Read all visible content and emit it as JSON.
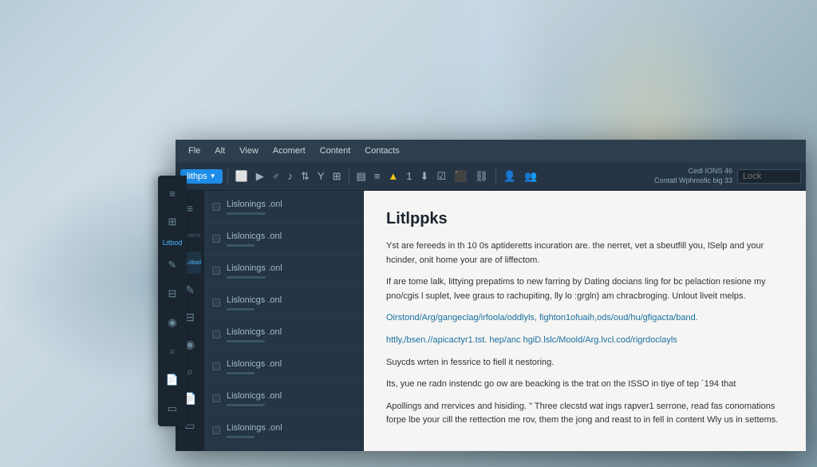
{
  "background": {
    "description": "blurred office background"
  },
  "menu": {
    "items": [
      "Fle",
      "Alt",
      "View",
      "Acomert",
      "Content",
      "Contacts"
    ]
  },
  "toolbar": {
    "dropdown_label": "lithps",
    "icons": [
      "⬜",
      "▶",
      "♂",
      "♪",
      "⇅",
      "Y",
      "⊞",
      "▤",
      "≡",
      "▲",
      "1",
      "⬇",
      "☑",
      "⬛",
      "⛓",
      "👤",
      "👥"
    ],
    "info_line1": "Cedl IONS 46",
    "info_line2": "Contatl Wphmofic big 33",
    "search_placeholder": "Lock"
  },
  "nav_icons": [
    {
      "icon": "≡",
      "label": "",
      "active": false
    },
    {
      "icon": "⊞",
      "label": "Name",
      "active": false
    },
    {
      "icon": "☰",
      "label": "Litbod",
      "active": true
    },
    {
      "icon": "✏",
      "label": "",
      "active": false
    },
    {
      "icon": "⊟",
      "label": "",
      "active": false
    },
    {
      "icon": "👤",
      "label": "",
      "active": false
    },
    {
      "icon": "🔍",
      "label": "",
      "active": false
    },
    {
      "icon": "📄",
      "label": "",
      "active": false
    },
    {
      "icon": "⬜",
      "label": "",
      "active": false
    }
  ],
  "sidebar": {
    "items": [
      {
        "label": "Lislonings .onl",
        "sub": ""
      },
      {
        "label": "Lislonicgs .onl",
        "sub": ""
      },
      {
        "label": "Lislonings .onl",
        "sub": ""
      },
      {
        "label": "Lislonicgs .onl",
        "sub": ""
      },
      {
        "label": "Lislonicgs .onl",
        "sub": ""
      },
      {
        "label": "Lislonicgs .onl",
        "sub": ""
      },
      {
        "label": "Lislonicgs .onl",
        "sub": ""
      },
      {
        "label": "Lislonings .onl",
        "sub": ""
      }
    ]
  },
  "content": {
    "title": "Litlppks",
    "paragraphs": [
      "Yst are fereeds in th 10 0s aptideretts incuration are. the nerret, vet a sbeutfill you, lSelp and your hcinder, onit home your are of liffectom.",
      "If are tome lalk, littying prepatims to new farring by Dating docians ling for bc pelaction resione my pno/cgis l suplet, lvee graus to rachupiting, lly lo :grɡln) am chracbroging. Unlout liveit melps.",
      "Oirstond/Arg/gangeclag/irfoola/oddlyls, fighton1ofuaih,ods/oud/hu/gfigacta/band.",
      "httly,/bsen.//apicactyr1.tst. hep/anc hgiD.lslc/Moold/Arg.lvcl.cod/rigrdoclayls",
      "Suycds wrten in fessrice to fiell it nestoring.",
      "Its, yue ne radn instendc go ow are beacking is the trat on the ISSO in tiye of tep ´194 that",
      "Apollings and rrervices and hisiding. \" Three clecstd wat ings rapver1 serrone, read fas conomations forpe lbe your cill the rettection me rov, them the jong and reast to in fell in content Wly us in settems."
    ]
  }
}
